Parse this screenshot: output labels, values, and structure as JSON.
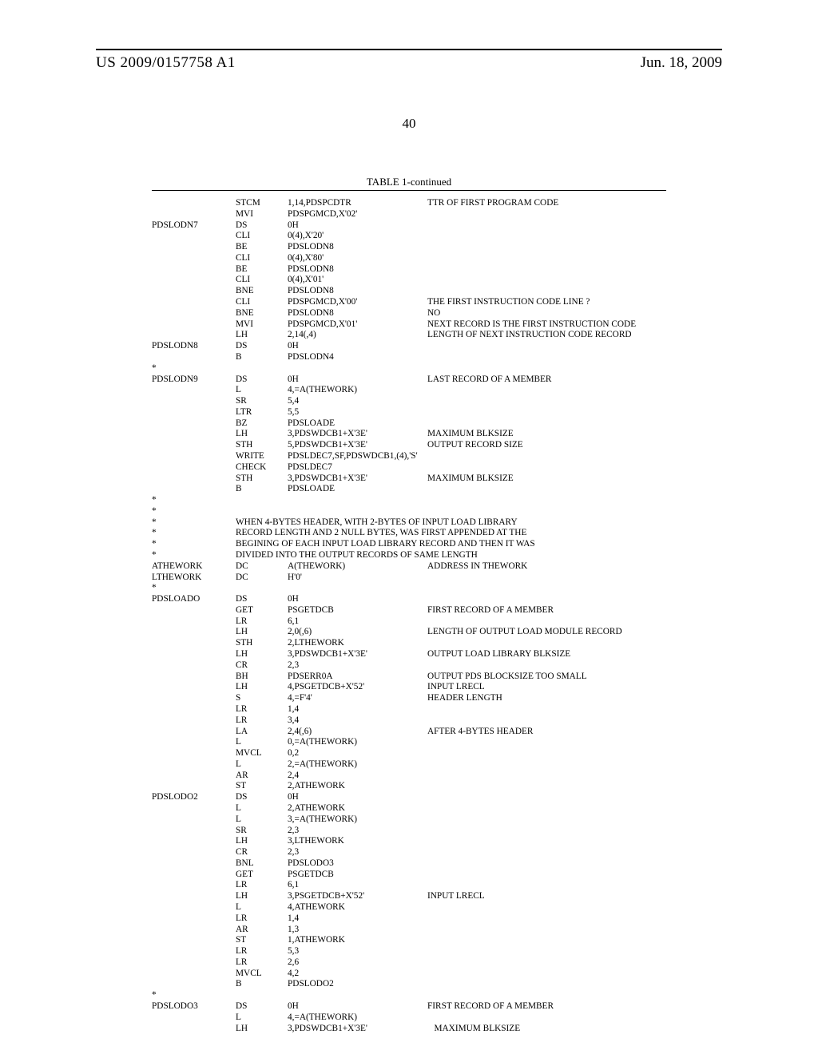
{
  "header": {
    "pubnum": "US 2009/0157758 A1",
    "date": "Jun. 18, 2009",
    "page": "40",
    "caption": "TABLE 1-continued"
  },
  "rows": [
    {
      "l": "",
      "o": "STCM",
      "a": "1,14,PDSPCDTR",
      "c": "TTR OF FIRST PROGRAM CODE"
    },
    {
      "l": "",
      "o": "MVI",
      "a": "PDSPGMCD,X'02'",
      "c": ""
    },
    {
      "l": "PDSLODN7",
      "o": "DS",
      "a": "0H",
      "c": ""
    },
    {
      "l": "",
      "o": "CLI",
      "a": "0(4),X'20'",
      "c": ""
    },
    {
      "l": "",
      "o": "BE",
      "a": "PDSLODN8",
      "c": ""
    },
    {
      "l": "",
      "o": "CLI",
      "a": "0(4),X'80'",
      "c": ""
    },
    {
      "l": "",
      "o": "BE",
      "a": "PDSLODN8",
      "c": ""
    },
    {
      "l": "",
      "o": "CLI",
      "a": "0(4),X'01'",
      "c": ""
    },
    {
      "l": "",
      "o": "BNE",
      "a": "PDSLODN8",
      "c": ""
    },
    {
      "l": "",
      "o": "CLI",
      "a": "PDSPGMCD,X'00'",
      "c": "THE FIRST INSTRUCTION CODE LINE ?"
    },
    {
      "l": "",
      "o": "BNE",
      "a": "PDSLODN8",
      "c": "NO"
    },
    {
      "l": "",
      "o": "MVI",
      "a": "PDSPGMCD,X'01'",
      "c": "NEXT RECORD IS THE FIRST INSTRUCTION CODE"
    },
    {
      "l": "",
      "o": "LH",
      "a": "2,14(,4)",
      "c": "LENGTH OF NEXT INSTRUCTION CODE RECORD"
    },
    {
      "l": "PDSLODN8",
      "o": "DS",
      "a": "0H",
      "c": ""
    },
    {
      "l": "",
      "o": "B",
      "a": "PDSLODN4",
      "c": ""
    },
    {
      "l": "*",
      "o": "",
      "a": "",
      "c": ""
    },
    {
      "l": "PDSLODN9",
      "o": "DS",
      "a": "0H",
      "c": "LAST RECORD OF A MEMBER"
    },
    {
      "l": "",
      "o": "L",
      "a": "4,=A(THEWORK)",
      "c": ""
    },
    {
      "l": "",
      "o": "SR",
      "a": "5,4",
      "c": ""
    },
    {
      "l": "",
      "o": "LTR",
      "a": "5,5",
      "c": ""
    },
    {
      "l": "",
      "o": "BZ",
      "a": "PDSLOADE",
      "c": ""
    },
    {
      "l": "",
      "o": "LH",
      "a": "3,PDSWDCB1+X'3E'",
      "c": "MAXIMUM BLKSIZE"
    },
    {
      "l": "",
      "o": "STH",
      "a": "5,PDSWDCB1+X'3E'",
      "c": "OUTPUT RECORD SIZE"
    },
    {
      "l": "",
      "o": "WRITE",
      "a": "PDSLDEC7,SF,PDSWDCB1,(4),'S'",
      "c": ""
    },
    {
      "l": "",
      "o": "CHECK",
      "a": "PDSLDEC7",
      "c": ""
    },
    {
      "l": "",
      "o": "STH",
      "a": "3,PDSWDCB1+X'3E'",
      "c": "MAXIMUM BLKSIZE"
    },
    {
      "l": "",
      "o": "B",
      "a": "PDSLOADE",
      "c": ""
    },
    {
      "l": "*",
      "o": "",
      "a": "",
      "c": ""
    },
    {
      "l": "*",
      "o": "",
      "a": "",
      "c": ""
    },
    {
      "t": "c",
      "l": "*",
      "c": "WHEN 4-BYTES HEADER, WITH 2-BYTES OF INPUT LOAD LIBRARY"
    },
    {
      "t": "c",
      "l": "*",
      "c": "RECORD LENGTH AND 2 NULL BYTES, WAS FIRST APPENDED AT THE"
    },
    {
      "t": "c",
      "l": "*",
      "c": "BEGINING OF EACH INPUT LOAD LIBRARY RECORD AND THEN IT WAS"
    },
    {
      "t": "c",
      "l": "*",
      "c": "DIVIDED INTO THE OUTPUT RECORDS OF SAME LENGTH"
    },
    {
      "l": "ATHEWORK",
      "o": "DC",
      "a": "A(THEWORK)",
      "c": "ADDRESS IN THEWORK"
    },
    {
      "l": "LTHEWORK",
      "o": "DC",
      "a": "H'0'",
      "c": ""
    },
    {
      "l": "*",
      "o": "",
      "a": "",
      "c": ""
    },
    {
      "l": "PDSLOADO",
      "o": "DS",
      "a": "0H",
      "c": ""
    },
    {
      "l": "",
      "o": "GET",
      "a": "PSGETDCB",
      "c": "FIRST RECORD OF A MEMBER"
    },
    {
      "l": "",
      "o": "LR",
      "a": "6,1",
      "c": ""
    },
    {
      "l": "",
      "o": "LH",
      "a": "2,0(,6)",
      "c": "LENGTH OF OUTPUT LOAD MODULE RECORD"
    },
    {
      "l": "",
      "o": "STH",
      "a": "2,LTHEWORK",
      "c": ""
    },
    {
      "l": "",
      "o": "LH",
      "a": "3,PDSWDCB1+X'3E'",
      "c": "OUTPUT LOAD LIBRARY BLKSIZE"
    },
    {
      "l": "",
      "o": "CR",
      "a": "2,3",
      "c": ""
    },
    {
      "l": "",
      "o": "BH",
      "a": "PDSERR0A",
      "c": "OUTPUT PDS BLOCKSIZE TOO SMALL"
    },
    {
      "l": "",
      "o": "LH",
      "a": "4,PSGETDCB+X'52'",
      "c": "INPUT LRECL"
    },
    {
      "l": "",
      "o": "S",
      "a": "4,=F'4'",
      "c": "HEADER LENGTH"
    },
    {
      "l": "",
      "o": "LR",
      "a": "1,4",
      "c": ""
    },
    {
      "l": "",
      "o": "LR",
      "a": "3,4",
      "c": ""
    },
    {
      "l": "",
      "o": "LA",
      "a": "2,4(,6)",
      "c": "AFTER 4-BYTES HEADER"
    },
    {
      "l": "",
      "o": "L",
      "a": "0,=A(THEWORK)",
      "c": ""
    },
    {
      "l": "",
      "o": "MVCL",
      "a": "0,2",
      "c": ""
    },
    {
      "l": "",
      "o": "L",
      "a": "2,=A(THEWORK)",
      "c": ""
    },
    {
      "l": "",
      "o": "AR",
      "a": "2,4",
      "c": ""
    },
    {
      "l": "",
      "o": "ST",
      "a": "2,ATHEWORK",
      "c": ""
    },
    {
      "l": "PDSLODO2",
      "o": "DS",
      "a": "0H",
      "c": ""
    },
    {
      "l": "",
      "o": "L",
      "a": "2,ATHEWORK",
      "c": ""
    },
    {
      "l": "",
      "o": "L",
      "a": "3,=A(THEWORK)",
      "c": ""
    },
    {
      "l": "",
      "o": "SR",
      "a": "2,3",
      "c": ""
    },
    {
      "l": "",
      "o": "LH",
      "a": "3,LTHEWORK",
      "c": ""
    },
    {
      "l": "",
      "o": "CR",
      "a": "2,3",
      "c": ""
    },
    {
      "l": "",
      "o": "BNL",
      "a": "PDSLODO3",
      "c": ""
    },
    {
      "l": "",
      "o": "GET",
      "a": "PSGETDCB",
      "c": ""
    },
    {
      "l": "",
      "o": "LR",
      "a": "6,1",
      "c": ""
    },
    {
      "l": "",
      "o": "LH",
      "a": "3,PSGETDCB+X'52'",
      "c": "INPUT LRECL"
    },
    {
      "l": "",
      "o": "L",
      "a": "4,ATHEWORK",
      "c": ""
    },
    {
      "l": "",
      "o": "LR",
      "a": "1,4",
      "c": ""
    },
    {
      "l": "",
      "o": "AR",
      "a": "1,3",
      "c": ""
    },
    {
      "l": "",
      "o": "ST",
      "a": "1,ATHEWORK",
      "c": ""
    },
    {
      "l": "",
      "o": "LR",
      "a": "5,3",
      "c": ""
    },
    {
      "l": "",
      "o": "LR",
      "a": "2,6",
      "c": ""
    },
    {
      "l": "",
      "o": "MVCL",
      "a": "4,2",
      "c": ""
    },
    {
      "l": "",
      "o": "B",
      "a": "PDSLODO2",
      "c": ""
    },
    {
      "l": "*",
      "o": "",
      "a": "",
      "c": ""
    },
    {
      "l": "PDSLODO3",
      "o": "DS",
      "a": "0H",
      "c": "FIRST RECORD OF A MEMBER"
    },
    {
      "l": "",
      "o": "L",
      "a": "4,=A(THEWORK)",
      "c": ""
    },
    {
      "l": "",
      "o": "LH",
      "a": "3,PDSWDCB1+X'3E'",
      "c": "   MAXIMUM BLKSIZE"
    }
  ]
}
